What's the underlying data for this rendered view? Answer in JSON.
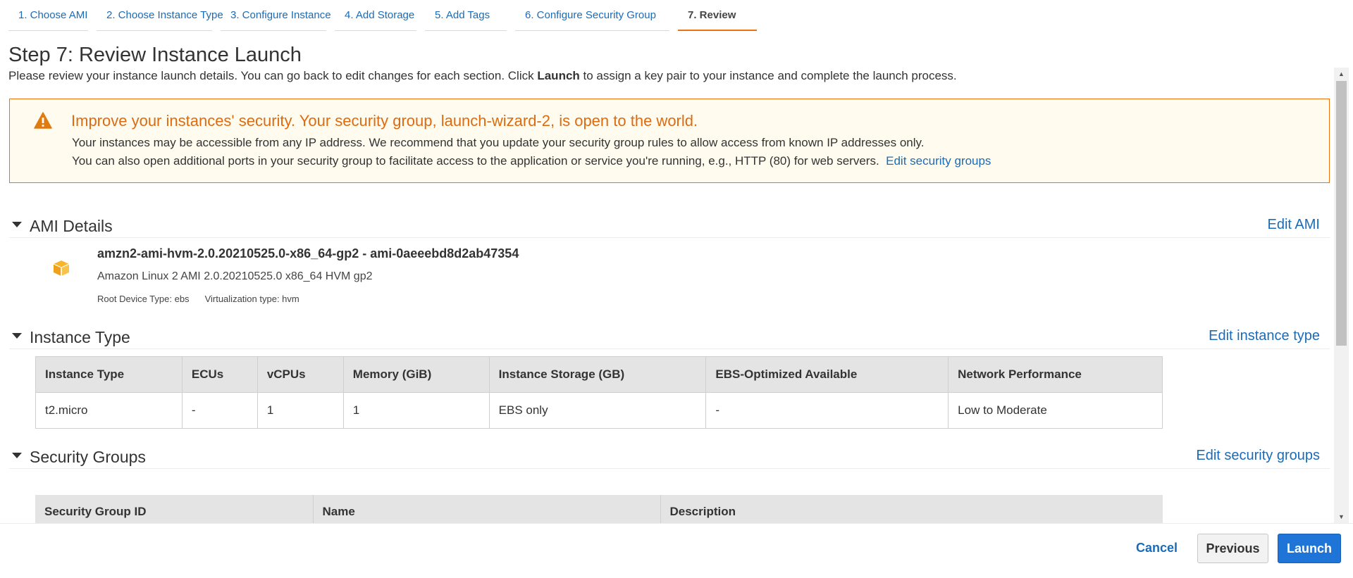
{
  "wizard": {
    "tabs": [
      {
        "label": "1. Choose AMI"
      },
      {
        "label": "2. Choose Instance Type"
      },
      {
        "label": "3. Configure Instance"
      },
      {
        "label": "4. Add Storage"
      },
      {
        "label": "5. Add Tags"
      },
      {
        "label": "6. Configure Security Group"
      },
      {
        "label": "7. Review"
      }
    ],
    "active_index": 6
  },
  "page": {
    "title": "Step 7: Review Instance Launch",
    "desc_before": "Please review your instance launch details. You can go back to edit changes for each section. Click ",
    "desc_bold": "Launch",
    "desc_after": " to assign a key pair to your instance and complete the launch process."
  },
  "warning": {
    "icon": "warning-triangle-icon",
    "title": "Improve your instances' security. Your security group, launch-wizard-2, is open to the world.",
    "line1": "Your instances may be accessible from any IP address. We recommend that you update your security group rules to allow access from known IP addresses only.",
    "line2": "You can also open additional ports in your security group to facilitate access to the application or service you're running, e.g., HTTP (80) for web servers.",
    "link": "Edit security groups"
  },
  "ami_section": {
    "title": "AMI Details",
    "edit": "Edit AMI",
    "icon": "cube-icon",
    "name": "amzn2-ami-hvm-2.0.20210525.0-x86_64-gp2 - ami-0aeeebd8d2ab47354",
    "description": "Amazon Linux 2 AMI 2.0.20210525.0 x86_64 HVM gp2",
    "root_device": "Root Device Type: ebs",
    "virtualization": "Virtualization type: hvm"
  },
  "instance_section": {
    "title": "Instance Type",
    "edit": "Edit instance type",
    "columns": [
      "Instance Type",
      "ECUs",
      "vCPUs",
      "Memory (GiB)",
      "Instance Storage (GB)",
      "EBS-Optimized Available",
      "Network Performance"
    ],
    "row": [
      "t2.micro",
      "-",
      "1",
      "1",
      "EBS only",
      "-",
      "Low to Moderate"
    ]
  },
  "security_section": {
    "title": "Security Groups",
    "edit": "Edit security groups",
    "columns": [
      "Security Group ID",
      "Name",
      "Description"
    ]
  },
  "footer": {
    "cancel": "Cancel",
    "previous": "Previous",
    "launch": "Launch"
  },
  "colors": {
    "accent": "#ec7211",
    "link": "#1b6bb6",
    "primary_button": "#1f74d8",
    "warning_bg": "#fffbef"
  }
}
